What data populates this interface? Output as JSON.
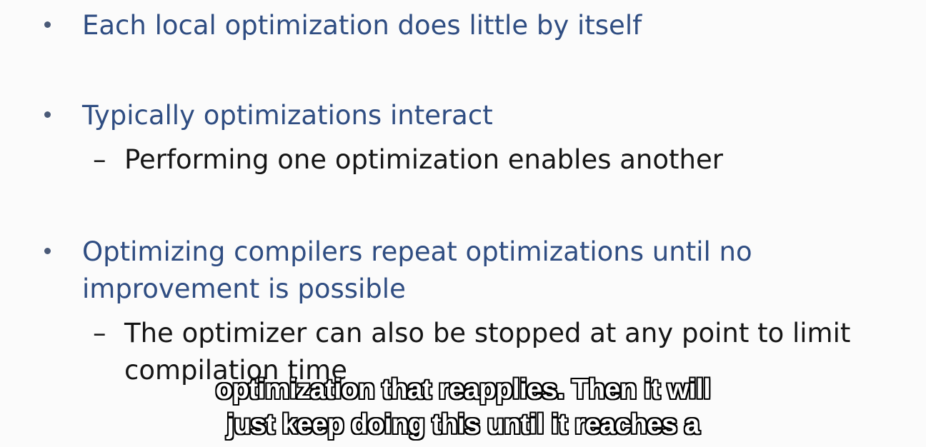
{
  "slide": {
    "bullets": [
      {
        "text": "Each local optimization does little by itself"
      },
      {
        "text": "Typically optimizations interact",
        "sub": "Performing one optimization enables another"
      },
      {
        "text_line1": "Optimizing compilers repeat optimizations until no",
        "text_line2": "improvement is possible",
        "sub_line1": "The optimizer can also be stopped at any point to limit",
        "sub_line2": "compilation time"
      }
    ],
    "dash": "–"
  },
  "captions": {
    "line1": "optimization that reapplies. Then it will",
    "line2": "just keep doing this until it reaches a"
  },
  "colors": {
    "bullet_text": "#2f4d82",
    "sub_text": "#151515",
    "background": "#fbfbfb"
  }
}
